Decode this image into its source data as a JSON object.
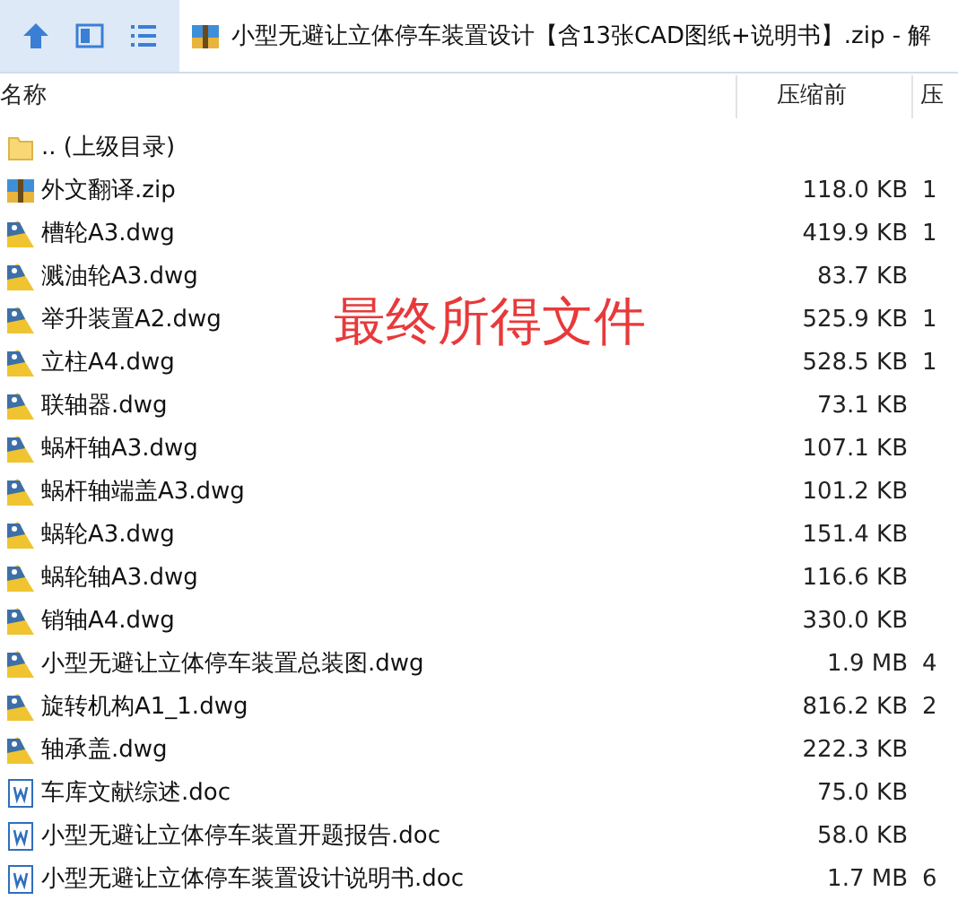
{
  "toolbar": {
    "path": "小型无避让立体停车装置设计【含13张CAD图纸+说明书】.zip - 解"
  },
  "columns": [
    "名称",
    "压缩前",
    "压"
  ],
  "files": [
    {
      "kind": "folder",
      "name": ".. (上级目录)"
    },
    {
      "kind": "zip",
      "name": "外文翻译.zip",
      "size": "118.0 KB",
      "packed": "1"
    },
    {
      "kind": "dwg",
      "name": "槽轮A3.dwg",
      "size": "419.9 KB",
      "packed": "1"
    },
    {
      "kind": "dwg",
      "name": "溅油轮A3.dwg",
      "size": "83.7 KB"
    },
    {
      "kind": "dwg",
      "name": "举升装置A2.dwg",
      "size": "525.9 KB",
      "packed": "1"
    },
    {
      "kind": "dwg",
      "name": "立柱A4.dwg",
      "size": "528.5 KB",
      "packed": "1"
    },
    {
      "kind": "dwg",
      "name": "联轴器.dwg",
      "size": "73.1 KB"
    },
    {
      "kind": "dwg",
      "name": "蜗杆轴A3.dwg",
      "size": "107.1 KB"
    },
    {
      "kind": "dwg",
      "name": "蜗杆轴端盖A3.dwg",
      "size": "101.2 KB"
    },
    {
      "kind": "dwg",
      "name": "蜗轮A3.dwg",
      "size": "151.4 KB"
    },
    {
      "kind": "dwg",
      "name": "蜗轮轴A3.dwg",
      "size": "116.6 KB"
    },
    {
      "kind": "dwg",
      "name": "销轴A4.dwg",
      "size": "330.0 KB"
    },
    {
      "kind": "dwg",
      "name": "小型无避让立体停车装置总装图.dwg",
      "size": "1.9 MB",
      "packed": "4"
    },
    {
      "kind": "dwg",
      "name": "旋转机构A1_1.dwg",
      "size": "816.2 KB",
      "packed": "2"
    },
    {
      "kind": "dwg",
      "name": "轴承盖.dwg",
      "size": "222.3 KB"
    },
    {
      "kind": "doc",
      "name": "车库文献综述.doc",
      "size": "75.0 KB"
    },
    {
      "kind": "doc",
      "name": "小型无避让立体停车装置开题报告.doc",
      "size": "58.0 KB"
    },
    {
      "kind": "doc",
      "name": "小型无避让立体停车装置设计说明书.doc",
      "size": "1.7 MB",
      "packed": "6"
    }
  ],
  "overlay_caption": "最终所得文件"
}
